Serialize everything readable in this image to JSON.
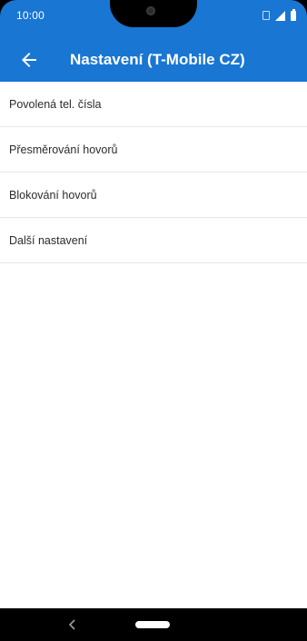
{
  "status_bar": {
    "time": "10:00",
    "icons": [
      "sim-icon",
      "signal-icon",
      "battery-icon"
    ]
  },
  "app_bar": {
    "back_icon": "arrow-left-icon",
    "title": "Nastavení (T-Mobile CZ)"
  },
  "settings": {
    "items": [
      {
        "label": "Povolená tel. čísla"
      },
      {
        "label": "Přesměrování hovorů"
      },
      {
        "label": "Blokování hovorů"
      },
      {
        "label": "Další nastavení"
      }
    ]
  },
  "navigation_bar": {
    "back_icon": "chevron-left-icon",
    "home_icon": "home-pill-icon"
  },
  "colors": {
    "primary": "#1976d2",
    "background": "#ffffff",
    "text": "#2b2b2b",
    "divider": "#e6e6e6",
    "nav_bar": "#000000"
  }
}
